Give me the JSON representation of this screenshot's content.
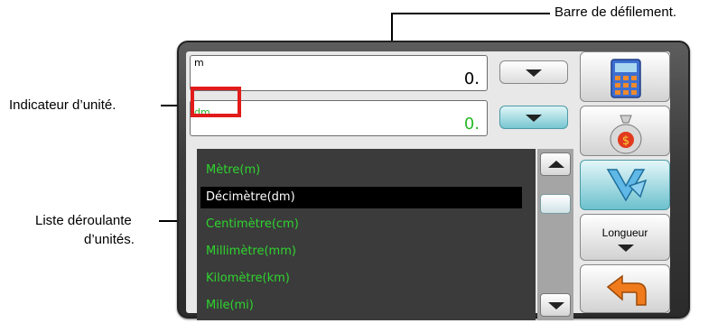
{
  "callouts": {
    "scrollbar": "Barre de défilement.",
    "unit_indicator": "Indicateur d’unité.",
    "unit_list_line1": "Liste déroulante",
    "unit_list_line2": "d’unités."
  },
  "fields": {
    "top": {
      "unit": "m",
      "value": "0."
    },
    "bottom": {
      "unit": "dm",
      "value": "0."
    }
  },
  "unit_list": {
    "items": [
      "Mètre(m)",
      "Décimètre(dm)",
      "Centimètre(cm)",
      "Millimètre(mm)",
      "Kilomètre(km)",
      "Mile(mi)"
    ],
    "selected_index": 1
  },
  "sidebar": {
    "category_label": "Longueur"
  },
  "icons": {
    "calculator": "calculator-icon",
    "currency": "money-bag-icon",
    "conversion": "converter-icon",
    "back": "back-arrow-icon"
  },
  "colors": {
    "list_text": "#2fd52f",
    "list_bg": "#3b3b3b",
    "selected_bg": "#000000",
    "highlight": "#e21b1b",
    "accent_teal": "#6cc1cd"
  }
}
